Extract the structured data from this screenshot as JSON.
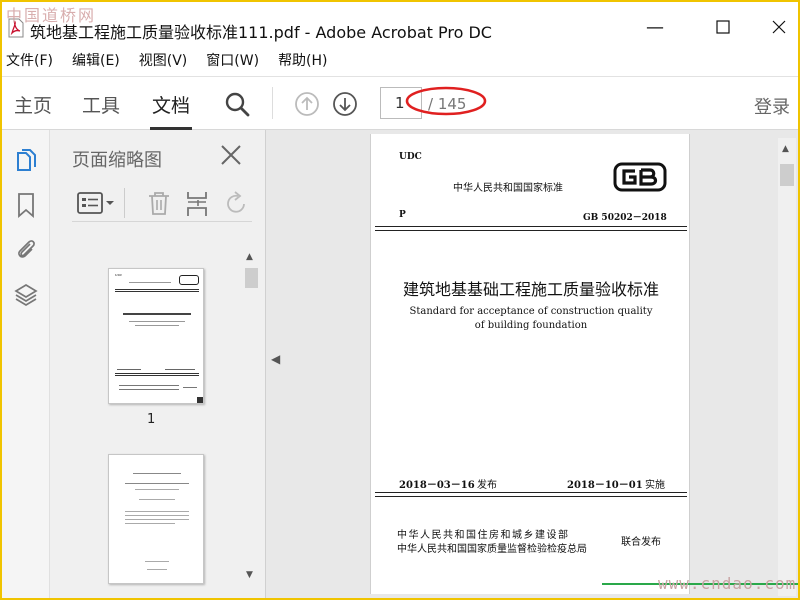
{
  "window": {
    "title": "筑地基工程施工质量验收标准111.pdf - Adobe Acrobat Pro DC",
    "minimize_glyph": "—",
    "maximize_glyph": "☐",
    "close_glyph": "✕"
  },
  "watermark_top": "中国道桥网",
  "watermark_bottom": "www.cndao.com",
  "menu": [
    "文件(F)",
    "编辑(E)",
    "视图(V)",
    "窗口(W)",
    "帮助(H)"
  ],
  "toolbar": {
    "tabs": [
      "主页",
      "工具",
      "文档"
    ],
    "active_tab": "文档",
    "current_page": "1",
    "total_pages": "/ 145",
    "login_label": "登录"
  },
  "thumbnails_panel": {
    "title": "页面缩略图",
    "thumbnail_label": "1"
  },
  "document_page": {
    "udc": "UDC",
    "national_standard": "中华人民共和国国家标准",
    "p_label": "P",
    "code": "GB 50202－2018",
    "title_cn": "建筑地基基础工程施工质量验收标准",
    "title_en_line1": "Standard for acceptance of construction quality",
    "title_en_line2": "of building foundation",
    "publish_date": "2018－03－16",
    "publish_label": "发布",
    "effective_date": "2018－10－01",
    "effective_label": "实施",
    "issuer1": "中华人民共和国住房和城乡建设部",
    "issuer2": "中华人民共和国国家质量监督检验检疫总局",
    "joint_label": "联合发布"
  },
  "colors": {
    "frame_border": "#f0c400",
    "annotation": "#e02020",
    "pdf_icon": "#c8102e"
  },
  "icons": [
    "pdf-file-icon",
    "search-icon",
    "prev-page-icon",
    "next-page-icon",
    "pages-icon",
    "bookmark-icon",
    "attachment-icon",
    "layers-icon",
    "thumbnail-options-icon",
    "delete-icon",
    "insert-page-icon",
    "rotate-icon",
    "close-icon",
    "gb-logo"
  ]
}
